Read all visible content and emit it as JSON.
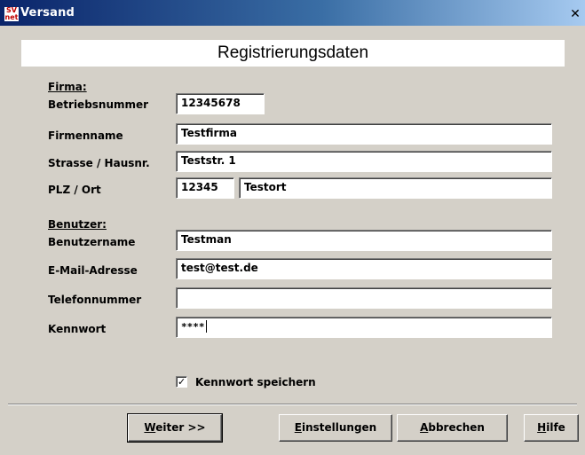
{
  "window": {
    "title": "Versand",
    "icon_text": "SV\nnet",
    "close_glyph": "✕"
  },
  "header": {
    "title": "Registrierungsdaten"
  },
  "firma": {
    "section_label": "Firma:",
    "betriebsnummer": {
      "label": "Betriebsnummer",
      "value": "12345678"
    },
    "firmenname": {
      "label": "Firmenname",
      "value": "Testfirma"
    },
    "strasse": {
      "label": "Strasse / Hausnr.",
      "value": "Teststr. 1"
    },
    "plz_ort": {
      "label": "PLZ / Ort",
      "plz": "12345",
      "ort": "Testort"
    }
  },
  "benutzer": {
    "section_label": "Benutzer:",
    "benutzername": {
      "label": "Benutzername",
      "value": "Testman"
    },
    "email": {
      "label": "E-Mail-Adresse",
      "value": "test@test.de"
    },
    "telefon": {
      "label": "Telefonnummer",
      "value": ""
    },
    "kennwort": {
      "label": "Kennwort",
      "value": "****"
    }
  },
  "options": {
    "save_password": {
      "label": "Kennwort speichern",
      "checked": true,
      "check_glyph": "✓"
    }
  },
  "buttons": {
    "weiter": {
      "accel": "W",
      "rest": "eiter >>"
    },
    "einstellungen": {
      "accel": "E",
      "rest": "instellungen"
    },
    "abbrechen": {
      "accel": "A",
      "rest": "bbrechen"
    },
    "hilfe": {
      "accel": "H",
      "rest": "ilfe"
    }
  },
  "colors": {
    "dialog_bg": "#d4d0c8",
    "title_start": "#0a246a",
    "title_end": "#a6caf0"
  }
}
